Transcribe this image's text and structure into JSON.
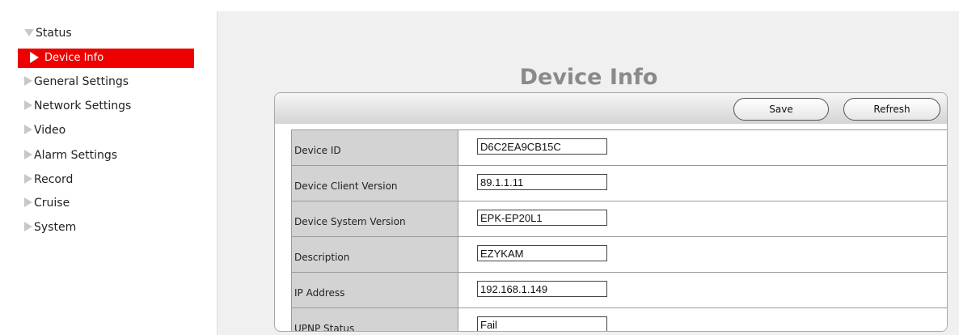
{
  "sidebar": {
    "status_label": "Status",
    "active_label": "Device Info",
    "items": [
      "General Settings",
      "Network Settings",
      "Video",
      "Alarm Settings",
      "Record",
      "Cruise",
      "System"
    ]
  },
  "main": {
    "title": "Device Info",
    "toolbar": {
      "save_label": "Save",
      "refresh_label": "Refresh"
    },
    "rows": [
      {
        "label": "Device ID",
        "value": "D6C2EA9CB15C"
      },
      {
        "label": "Device Client Version",
        "value": "89.1.1.11"
      },
      {
        "label": "Device System Version",
        "value": "EPK-EP20L1"
      },
      {
        "label": "Description",
        "value": "EZYKAM"
      },
      {
        "label": "IP Address",
        "value": "192.168.1.149"
      },
      {
        "label": "UPNP Status",
        "value": "Fail"
      }
    ]
  },
  "colors": {
    "active_bg": "#ef0000",
    "title": "#8a8a8a",
    "label_bg": "#d3d3d3",
    "content_bg": "#f0f0f0"
  }
}
